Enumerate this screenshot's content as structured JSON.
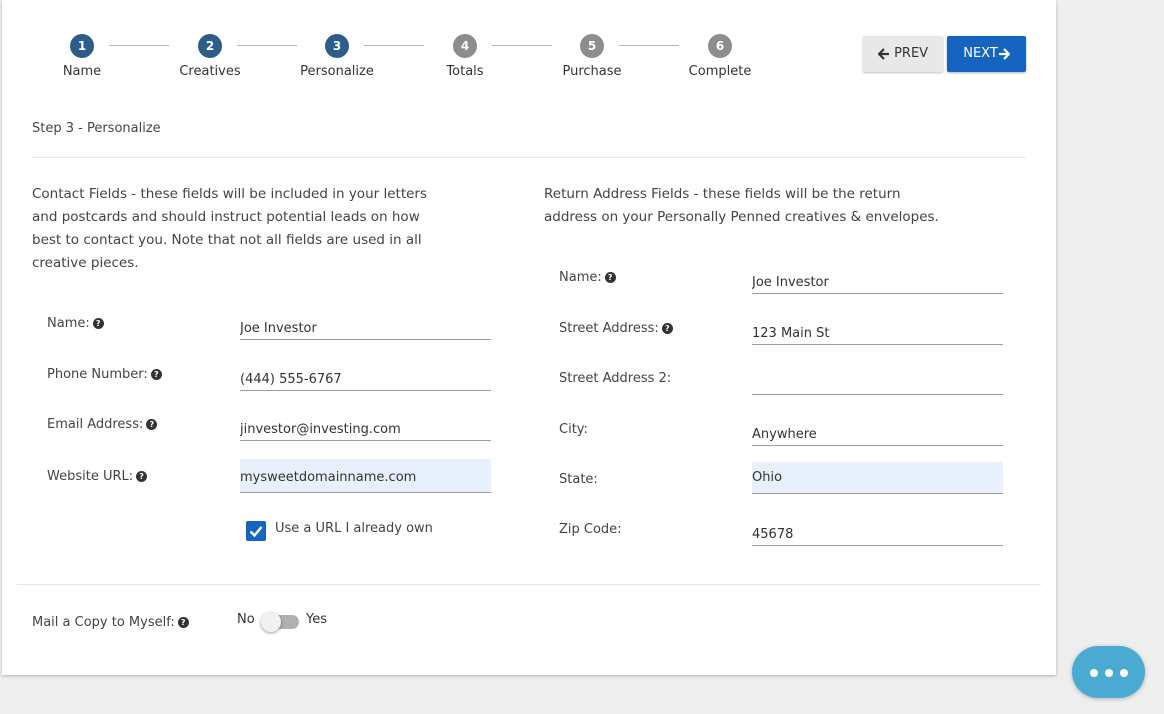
{
  "stepper": {
    "steps": [
      {
        "num": "1",
        "label": "Name"
      },
      {
        "num": "2",
        "label": "Creatives"
      },
      {
        "num": "3",
        "label": "Personalize"
      },
      {
        "num": "4",
        "label": "Totals"
      },
      {
        "num": "5",
        "label": "Purchase"
      },
      {
        "num": "6",
        "label": "Complete"
      }
    ],
    "active_color": "#2d5d8b",
    "inactive_color": "#8d8d8d"
  },
  "nav": {
    "prev_label": "PREV",
    "next_label": "NEXT",
    "prev_icon": "arrow-left-icon",
    "next_icon": "arrow-right-icon"
  },
  "step_title": "Step 3 - Personalize",
  "contact": {
    "intro": "Contact Fields - these fields will be included in your letters and postcards and should instruct potential leads on how best to contact you. Note that not all fields are used in all creative pieces.",
    "name_label": "Name:",
    "name_value": "Joe Investor",
    "phone_label": "Phone Number:",
    "phone_value": "(444) 555-6767",
    "email_label": "Email Address:",
    "email_value": "jinvestor@investing.com",
    "website_label": "Website URL:",
    "website_value": "mysweetdomainname.com",
    "use_url_label": "Use a URL I already own",
    "use_url_checked": true
  },
  "return_address": {
    "intro": "Return Address Fields - these fields will be the return address on your Personally Penned creatives & envelopes.",
    "name_label": "Name:",
    "name_value": "Joe Investor",
    "street_label": "Street Address:",
    "street_value": "123 Main St",
    "street2_label": "Street Address 2:",
    "street2_value": "",
    "city_label": "City:",
    "city_value": "Anywhere",
    "state_label": "State:",
    "state_value": "Ohio",
    "zip_label": "Zip Code:",
    "zip_value": "45678"
  },
  "mail_copy": {
    "label": "Mail a Copy to Myself:",
    "no_label": "No",
    "yes_label": "Yes",
    "enabled": false
  },
  "help_icon": "question-circle-icon",
  "chat_icon": "ellipsis-icon",
  "colors": {
    "primary": "#1565c0",
    "autofill": "#e8f0fe",
    "chat": "#4aaad4"
  }
}
